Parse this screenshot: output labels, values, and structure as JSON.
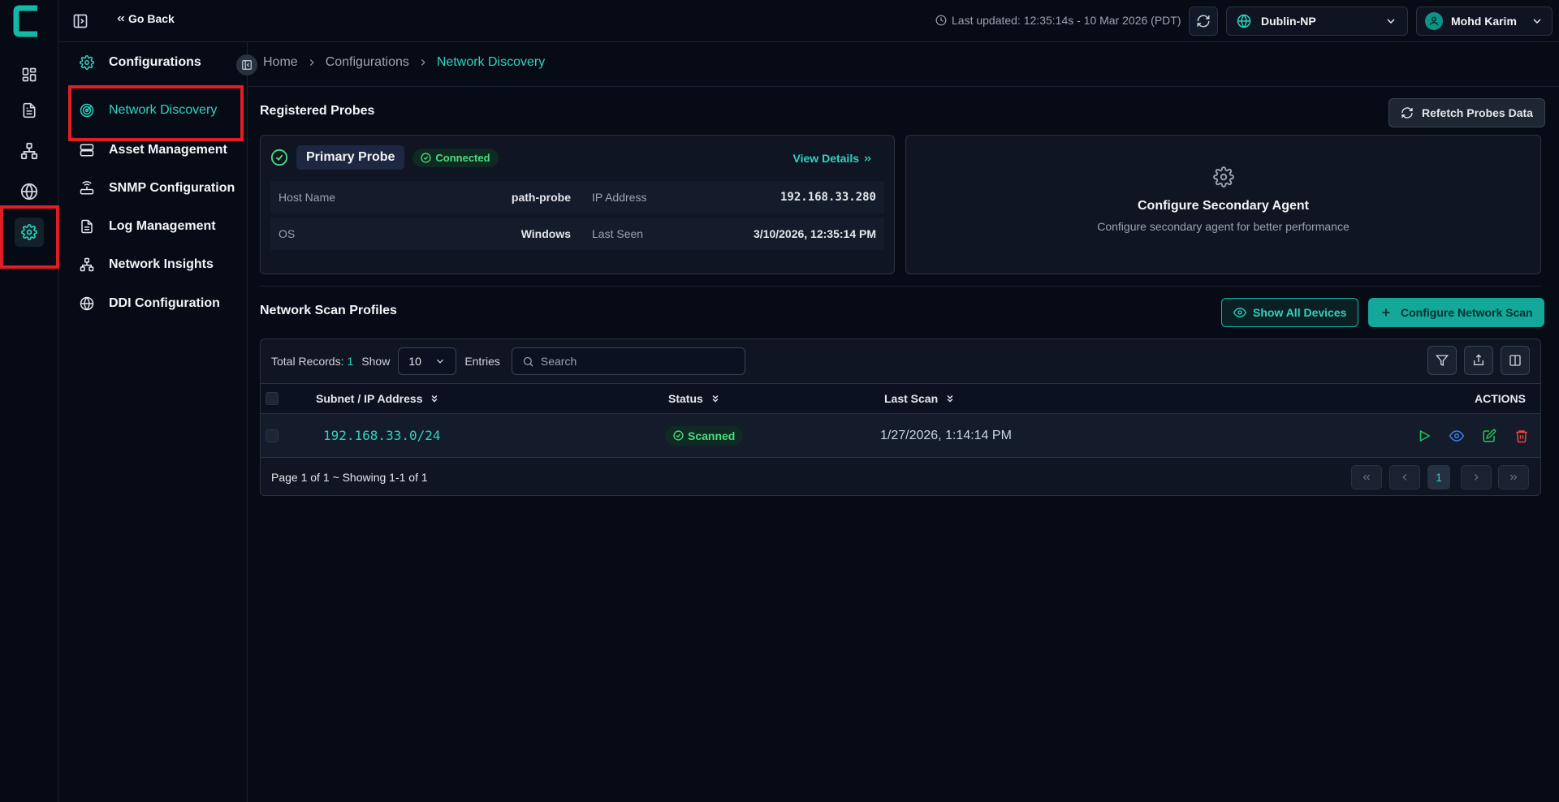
{
  "app": {
    "logo_letter": "C",
    "accent_color": "#2dd4bf",
    "highlight_color": "#e11d26"
  },
  "rail": {
    "items": [
      {
        "icon": "dashboard-icon"
      },
      {
        "icon": "document-icon"
      },
      {
        "icon": "topology-icon"
      },
      {
        "icon": "globe-icon"
      },
      {
        "icon": "settings-icon",
        "active": true
      }
    ]
  },
  "topbar": {
    "go_back": "Go Back",
    "last_updated": "Last updated: 12:35:14s - 10 Mar 2026 (PDT)",
    "site": "Dublin-NP",
    "user": "Mohd Karim"
  },
  "subnav": {
    "title": "Configurations",
    "items": [
      {
        "label": "Network Discovery",
        "icon": "radar-icon",
        "active": true
      },
      {
        "label": "Asset Management",
        "icon": "server-icon"
      },
      {
        "label": "SNMP Configuration",
        "icon": "router-icon"
      },
      {
        "label": "Log Management",
        "icon": "document-icon"
      },
      {
        "label": "Network Insights",
        "icon": "topology-icon"
      },
      {
        "label": "DDI Configuration",
        "icon": "globe-icon"
      }
    ]
  },
  "breadcrumb": {
    "home": "Home",
    "parent": "Configurations",
    "current": "Network Discovery"
  },
  "probes": {
    "title": "Registered Probes",
    "refetch_label": "Refetch Probes Data",
    "primary": {
      "name": "Primary Probe",
      "status": "Connected",
      "view_details": "View Details",
      "host_name_label": "Host Name",
      "host_name": "path-probe",
      "ip_label": "IP Address",
      "ip": "192.168.33.280",
      "os_label": "OS",
      "os": "Windows",
      "last_seen_label": "Last Seen",
      "last_seen": "3/10/2026, 12:35:14 PM"
    },
    "secondary": {
      "title": "Configure Secondary Agent",
      "subtitle": "Configure secondary agent for better performance"
    }
  },
  "scan_profiles": {
    "title": "Network Scan Profiles",
    "show_all_label": "Show All Devices",
    "configure_label": "Configure Network Scan",
    "toolbar": {
      "total_label": "Total Records:",
      "total": "1",
      "show_label": "Show",
      "page_size": "10",
      "entries_label": "Entries",
      "search_placeholder": "Search"
    },
    "columns": {
      "subnet": "Subnet / IP Address",
      "status": "Status",
      "last_scan": "Last Scan",
      "actions": "ACTIONS"
    },
    "rows": [
      {
        "subnet": "192.168.33.0/24",
        "status": "Scanned",
        "last_scan": "1/27/2026, 1:14:14 PM"
      }
    ],
    "footer": {
      "summary": "Page 1 of 1 ~ Showing 1-1 of 1",
      "current_page": "1"
    }
  }
}
